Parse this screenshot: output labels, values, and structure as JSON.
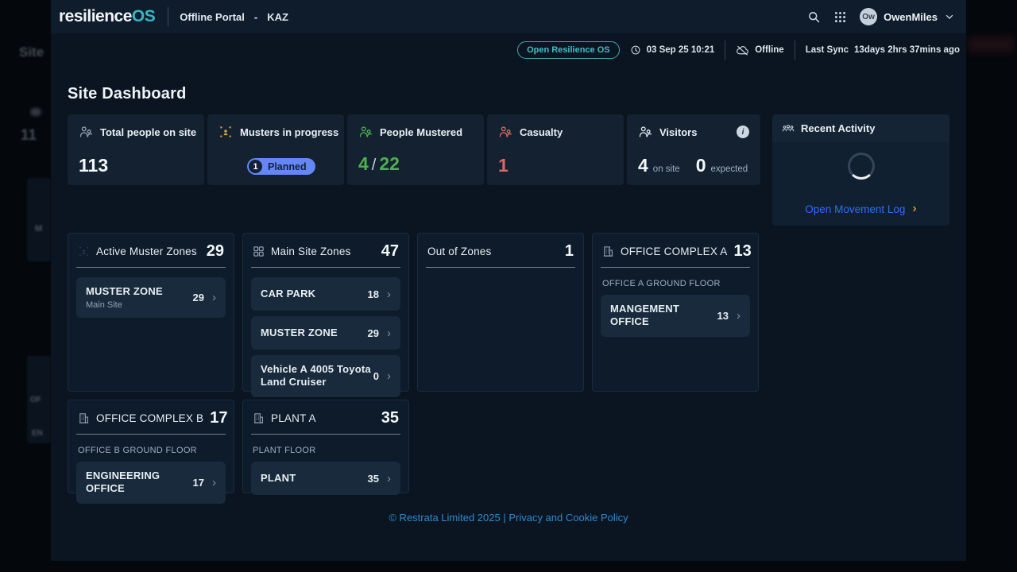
{
  "navbar": {
    "logo_main": "resilience",
    "logo_accent": "OS",
    "portal": "Offline Portal",
    "dash": "-",
    "site": "KAZ",
    "user_initials": "Ow",
    "user_name": "OwenMiles"
  },
  "statusbar": {
    "open_button": "Open Resilience OS",
    "datetime": "03 Sep 25 10:21",
    "connection": "Offline",
    "last_sync_label": "Last Sync",
    "last_sync_value": "13days 2hrs 37mins ago"
  },
  "page": {
    "title": "Site Dashboard"
  },
  "stats": {
    "total": {
      "label": "Total people on site",
      "value": "113"
    },
    "musters": {
      "label": "Musters in progress",
      "badge_count": "1",
      "badge_text": "Planned"
    },
    "mustered": {
      "label": "People Mustered",
      "current": "4",
      "separator": "/",
      "capacity": "22"
    },
    "casualty": {
      "label": "Casualty",
      "value": "1"
    },
    "visitors": {
      "label": "Visitors",
      "info_glyph": "i",
      "on_site_value": "4",
      "on_site_label": "on site",
      "expected_value": "0",
      "expected_label": "expected"
    }
  },
  "recent": {
    "title": "Recent Activity",
    "link_label": "Open Movement Log"
  },
  "zones": [
    {
      "title": "Active Muster Zones",
      "count": "29",
      "items": [
        {
          "name": "MUSTER ZONE",
          "sub": "Main Site",
          "value": "29"
        }
      ]
    },
    {
      "title": "Main Site Zones",
      "count": "47",
      "items": [
        {
          "name": "CAR PARK",
          "value": "18"
        },
        {
          "name": "MUSTER ZONE",
          "value": "29"
        },
        {
          "name": "Vehicle A 4005 Toyota Land Cruiser",
          "value": "0"
        }
      ]
    },
    {
      "title": "Out of Zones",
      "count": "1",
      "items": []
    },
    {
      "title": "OFFICE COMPLEX A",
      "count": "13",
      "floor": "OFFICE A GROUND FLOOR",
      "items": [
        {
          "name": "MANGEMENT OFFICE",
          "value": "13"
        }
      ]
    },
    {
      "title": "OFFICE COMPLEX B",
      "count": "17",
      "floor": "OFFICE B GROUND FLOOR",
      "items": [
        {
          "name": "ENGINEERING OFFICE",
          "value": "17"
        }
      ]
    },
    {
      "title": "PLANT A",
      "count": "35",
      "floor": "PLANT FLOOR",
      "items": [
        {
          "name": "PLANT",
          "value": "35"
        }
      ]
    }
  ],
  "footer": {
    "text": "© Restrata Limited 2025 | Privacy and Cookie Policy"
  },
  "ui": {
    "chevron_right": "›"
  },
  "ghost": {
    "fragments": [
      "Site",
      "11",
      "M",
      "OF",
      "EN"
    ]
  },
  "colors": {
    "accent_teal": "#35b8c4",
    "badge_blue": "#6487f5",
    "success_green": "#4caf50",
    "alert_red": "#e06565",
    "muster_yellow": "#dca83d",
    "link_blue": "#2d6ef5",
    "footer_link_blue": "#3189cb",
    "chevron_orange": "#e0862e"
  }
}
